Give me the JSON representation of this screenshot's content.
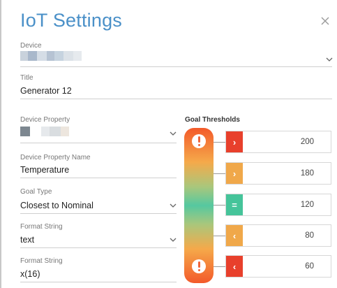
{
  "dialog": {
    "title": "IoT Settings",
    "accent_color": "#4a90c8"
  },
  "fields": {
    "device": {
      "label": "Device",
      "value_redacted": true
    },
    "title": {
      "label": "Title",
      "value": "Generator 12"
    },
    "device_property": {
      "label": "Device Property",
      "value_redacted": true
    },
    "device_property_name": {
      "label": "Device Property Name",
      "value": "Temperature"
    },
    "goal_type": {
      "label": "Goal Type",
      "value": "Closest to Nominal"
    },
    "format_string_1": {
      "label": "Format String",
      "value": "text"
    },
    "format_string_2": {
      "label": "Format String",
      "value": "x(16)"
    }
  },
  "goal_thresholds": {
    "title": "Goal Thresholds",
    "rows": [
      {
        "icon": "chevron-right-icon",
        "symbol": "›",
        "value": "200",
        "color": "#e8402c"
      },
      {
        "icon": "chevron-right-icon",
        "symbol": "›",
        "value": "180",
        "color": "#f0a84a"
      },
      {
        "icon": "equals-icon",
        "symbol": "=",
        "value": "120",
        "color": "#45c49a"
      },
      {
        "icon": "chevron-left-icon",
        "symbol": "‹",
        "value": "80",
        "color": "#f0a84a"
      },
      {
        "icon": "chevron-left-icon",
        "symbol": "‹",
        "value": "60",
        "color": "#e8402c"
      }
    ]
  }
}
